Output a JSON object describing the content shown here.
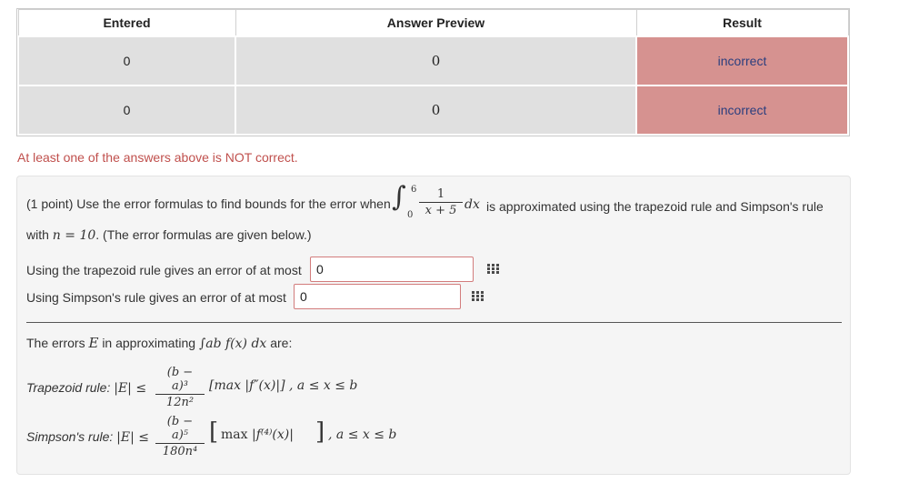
{
  "results_table": {
    "headers": [
      "Entered",
      "Answer Preview",
      "Result"
    ],
    "rows": [
      {
        "entered": "0",
        "preview": "0",
        "result": "incorrect"
      },
      {
        "entered": "0",
        "preview": "0",
        "result": "incorrect"
      }
    ],
    "incorrect_color": "#d69290"
  },
  "message": "At least one of the answers above is NOT correct.",
  "problem": {
    "intro": "(1 point) Use the error formulas to find bounds for the error when",
    "integral": {
      "upper": "6",
      "lower": "0",
      "numerator": "1",
      "denominator": "x + 5",
      "dx": "dx"
    },
    "after_integral": "is approximated using the trapezoid rule and Simpson's rule",
    "line2_prefix": "with",
    "n_math": "n = 10",
    "line2_suffix": ". (The error formulas are given below.)",
    "q1_label": "Using the trapezoid rule gives an error of at most",
    "q1_value": "0",
    "q2_label": "Using Simpson's rule gives an error of at most",
    "q2_value": "0",
    "errors_prefix": "The errors",
    "errors_E": "E",
    "errors_mid": "in approximating",
    "errors_integral": "∫ab f(x) dx",
    "errors_suffix": "are:",
    "trap_label": "Trapezoid rule:",
    "trap_lhs": "|E| ≤",
    "trap_num": "(b − a)³",
    "trap_den": "12n²",
    "trap_rhs": "[max |f″(x)|] , a ≤ x ≤ b",
    "simp_label": "Simpson's rule:",
    "simp_lhs": "|E| ≤",
    "simp_num": "(b − a)⁵",
    "simp_den": "180n⁴",
    "simp_rhs_max": "max",
    "simp_rhs_f": "|f⁽⁴⁾(x)|",
    "simp_rhs_tail": ", a ≤ x ≤ b"
  }
}
